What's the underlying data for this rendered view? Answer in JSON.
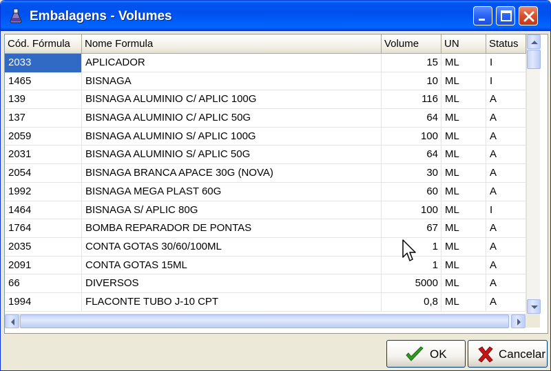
{
  "window": {
    "title": "Embalagens - Volumes",
    "icon": "flask-icon"
  },
  "table": {
    "columns": [
      "Cód. Fórmula",
      "Nome Formula",
      "Volume",
      "UN",
      "Status"
    ],
    "rows": [
      {
        "cod": "2033",
        "nome": "APLICADOR",
        "volume": "15",
        "un": "ML",
        "status": "I"
      },
      {
        "cod": "1465",
        "nome": "BISNAGA",
        "volume": "10",
        "un": "ML",
        "status": "I"
      },
      {
        "cod": "139",
        "nome": "BISNAGA ALUMINIO C/ APLIC 100G",
        "volume": "116",
        "un": "ML",
        "status": "A"
      },
      {
        "cod": "137",
        "nome": "BISNAGA ALUMINIO C/ APLIC 50G",
        "volume": "64",
        "un": "ML",
        "status": "A"
      },
      {
        "cod": "2059",
        "nome": "BISNAGA ALUMINIO S/ APLIC 100G",
        "volume": "100",
        "un": "ML",
        "status": "A"
      },
      {
        "cod": "2031",
        "nome": "BISNAGA ALUMINIO S/ APLIC 50G",
        "volume": "64",
        "un": "ML",
        "status": "A"
      },
      {
        "cod": "2054",
        "nome": "BISNAGA BRANCA APACE 30G (NOVA)",
        "volume": "30",
        "un": "ML",
        "status": "A"
      },
      {
        "cod": "1992",
        "nome": "BISNAGA MEGA PLAST 60G",
        "volume": "60",
        "un": "ML",
        "status": "A"
      },
      {
        "cod": "1464",
        "nome": "BISNAGA S/ APLIC 80G",
        "volume": "100",
        "un": "ML",
        "status": "I"
      },
      {
        "cod": "1764",
        "nome": "BOMBA REPARADOR DE PONTAS",
        "volume": "67",
        "un": "ML",
        "status": "A"
      },
      {
        "cod": "2035",
        "nome": "CONTA GOTAS  30/60/100ML",
        "volume": "1",
        "un": "ML",
        "status": "A"
      },
      {
        "cod": "2091",
        "nome": "CONTA GOTAS 15ML",
        "volume": "1",
        "un": "ML",
        "status": "A"
      },
      {
        "cod": "66",
        "nome": "DIVERSOS",
        "volume": "5000",
        "un": "ML",
        "status": "A"
      },
      {
        "cod": "1994",
        "nome": "FLACONTE TUBO J-10 CPT",
        "volume": "0,8",
        "un": "ML",
        "status": "A"
      }
    ],
    "selected_row": 0
  },
  "buttons": {
    "ok_label": "OK",
    "cancel_label": "Cancelar"
  },
  "colors": {
    "titlebar": "#0054e3",
    "selection": "#316ac5",
    "ok_check": "#2e9b1e",
    "cancel_x": "#c81414"
  }
}
